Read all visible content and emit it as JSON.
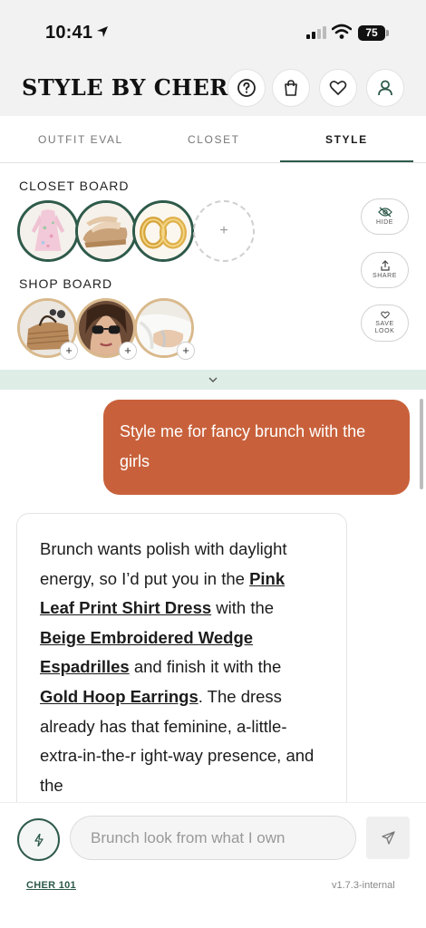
{
  "status_bar": {
    "time": "10:41",
    "battery": "75"
  },
  "header": {
    "title": "STYLE BY CHER"
  },
  "tabs": [
    {
      "label": "OUTFIT EVAL",
      "active": false
    },
    {
      "label": "CLOSET",
      "active": false
    },
    {
      "label": "STYLE",
      "active": true
    }
  ],
  "closet_board": {
    "label": "CLOSET BOARD",
    "items": [
      "pink-leaf-print-shirt-dress",
      "beige-embroidered-wedge-espadrilles",
      "gold-hoop-earrings"
    ],
    "add_symbol": "+"
  },
  "shop_board": {
    "label": "SHOP BOARD",
    "items": [
      "woven-straw-bag",
      "sunglasses-look",
      "white-sleeve-bracelet"
    ],
    "add_symbol": "+"
  },
  "side_actions": {
    "hide": "HIDE",
    "share": "SHARE",
    "save_look_line1": "SAVE",
    "save_look_line2": "LOOK"
  },
  "chat": {
    "user_message": "Style me for fancy brunch with the girls",
    "ai_message": {
      "p1": "Brunch wants polish with daylight energy, so I’d put you in the ",
      "link1": "Pink Leaf Print Shirt Dress",
      "p2": " with the ",
      "link2": "Beige Embroidered Wedge Espadrilles",
      "p3": " and finish it with the ",
      "link3": "Gold Hoop Earrings",
      "p4": ". The dress already has that feminine, a-little-extra-in-the-r ight-way presence, and the"
    }
  },
  "input": {
    "placeholder": "Brunch look from what I own"
  },
  "footer": {
    "link": "CHER 101",
    "version": "v1.7.3-internal"
  },
  "colors": {
    "accent_green": "#2e5a4a",
    "user_bubble": "#c8613b",
    "collapse_bar": "#deeee6",
    "shop_ring": "#d9b98c"
  },
  "icons": [
    "location-arrow-icon",
    "signal-icon",
    "wifi-icon",
    "battery-icon",
    "help-icon",
    "shopping-bag-icon",
    "heart-icon",
    "user-icon",
    "eye-off-icon",
    "share-icon",
    "heart-outline-icon",
    "chevron-down-icon",
    "bolt-icon",
    "send-icon"
  ]
}
